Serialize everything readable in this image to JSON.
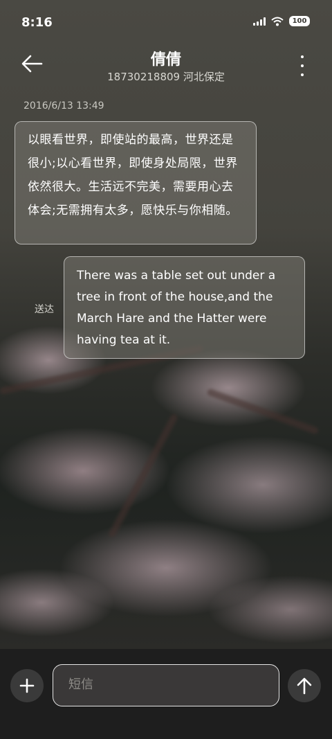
{
  "status_bar": {
    "time": "8:16",
    "battery": "100"
  },
  "header": {
    "contact_name": "倩倩",
    "contact_detail": "18730218809 河北保定"
  },
  "thread": {
    "timestamp": "2016/6/13 13:49",
    "incoming_message": "以眼看世界，即使站的最高，世界还是很小;以心看世界，即使身处局限，世界依然很大。生活远不完美，需要用心去体会;无需拥有太多，愿快乐与你相随。",
    "outgoing_message": "There was a table set out under a tree in front of the house,and the March Hare and the Hatter were having tea at it.",
    "outgoing_status": "送达"
  },
  "composer": {
    "placeholder": "短信"
  },
  "icons": [
    "back-arrow-icon",
    "more-vertical-icon",
    "plus-icon",
    "send-arrow-icon",
    "signal-icon",
    "wifi-icon",
    "battery-icon"
  ]
}
